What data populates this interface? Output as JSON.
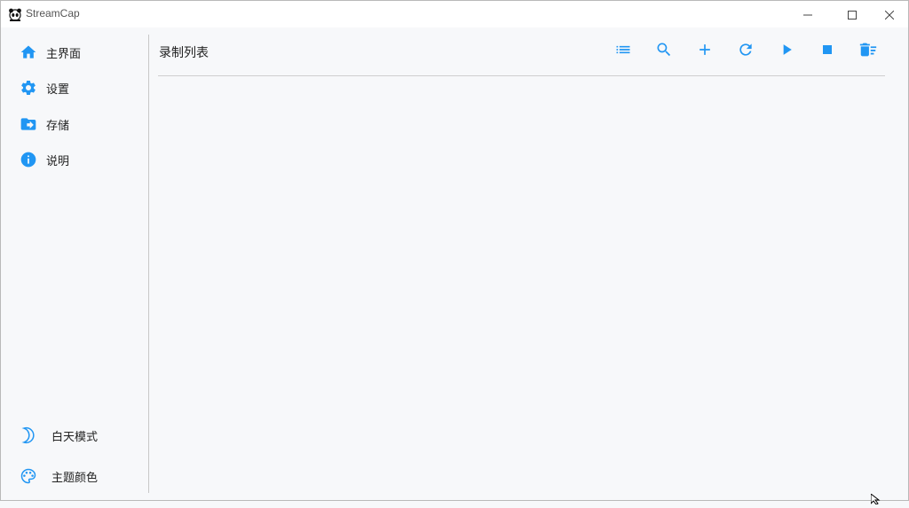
{
  "window": {
    "app_title": "StreamCap",
    "controls": {
      "minimize": "minimize-icon",
      "maximize": "maximize-icon",
      "close": "close-icon"
    }
  },
  "sidebar": {
    "items": [
      {
        "label": "主界面",
        "icon": "home-icon"
      },
      {
        "label": "设置",
        "icon": "gear-icon"
      },
      {
        "label": "存储",
        "icon": "folder-icon"
      },
      {
        "label": "说明",
        "icon": "info-icon"
      }
    ],
    "bottom": {
      "theme_mode": {
        "label": "白天模式",
        "icon": "moon-icon"
      },
      "theme_color": {
        "label": "主题颜色",
        "icon": "palette-icon"
      }
    }
  },
  "main": {
    "title": "录制列表",
    "toolbar": [
      "list-icon",
      "search-icon",
      "add-icon",
      "refresh-icon",
      "play-icon",
      "stop-icon",
      "delete-all-icon"
    ]
  },
  "colors": {
    "accent": "#2196f3",
    "background": "#f7f8fa",
    "titlebar": "#ffffff"
  }
}
